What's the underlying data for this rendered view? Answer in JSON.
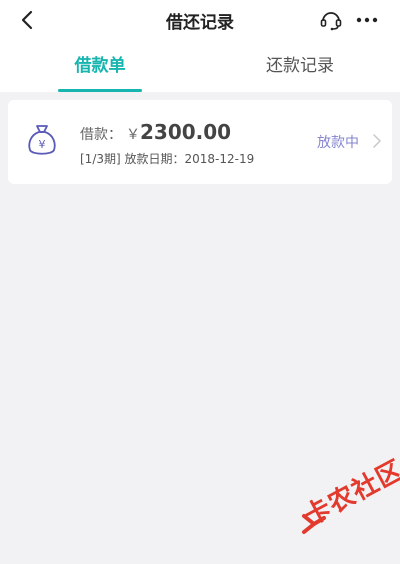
{
  "nav": {
    "title": "借还记录",
    "back_icon": "chevron-left-icon",
    "support_icon": "customer-service-headset-icon",
    "more_icon": "more-dots-icon"
  },
  "tabs": [
    {
      "label": "借款单",
      "active": true
    },
    {
      "label": "还款记录",
      "active": false
    }
  ],
  "loan": {
    "icon": "money-bag-icon",
    "amount_label": "借款：",
    "currency": "￥",
    "amount": "2300.00",
    "detail": "[1/3期] 放款日期：2018-12-19",
    "status": "放款中"
  },
  "watermark": {
    "text": "卡农社区"
  },
  "colors": {
    "accent": "#16b5b0",
    "status": "#8585d0",
    "background": "#f2f2f5",
    "watermark": "#e23a2c"
  }
}
